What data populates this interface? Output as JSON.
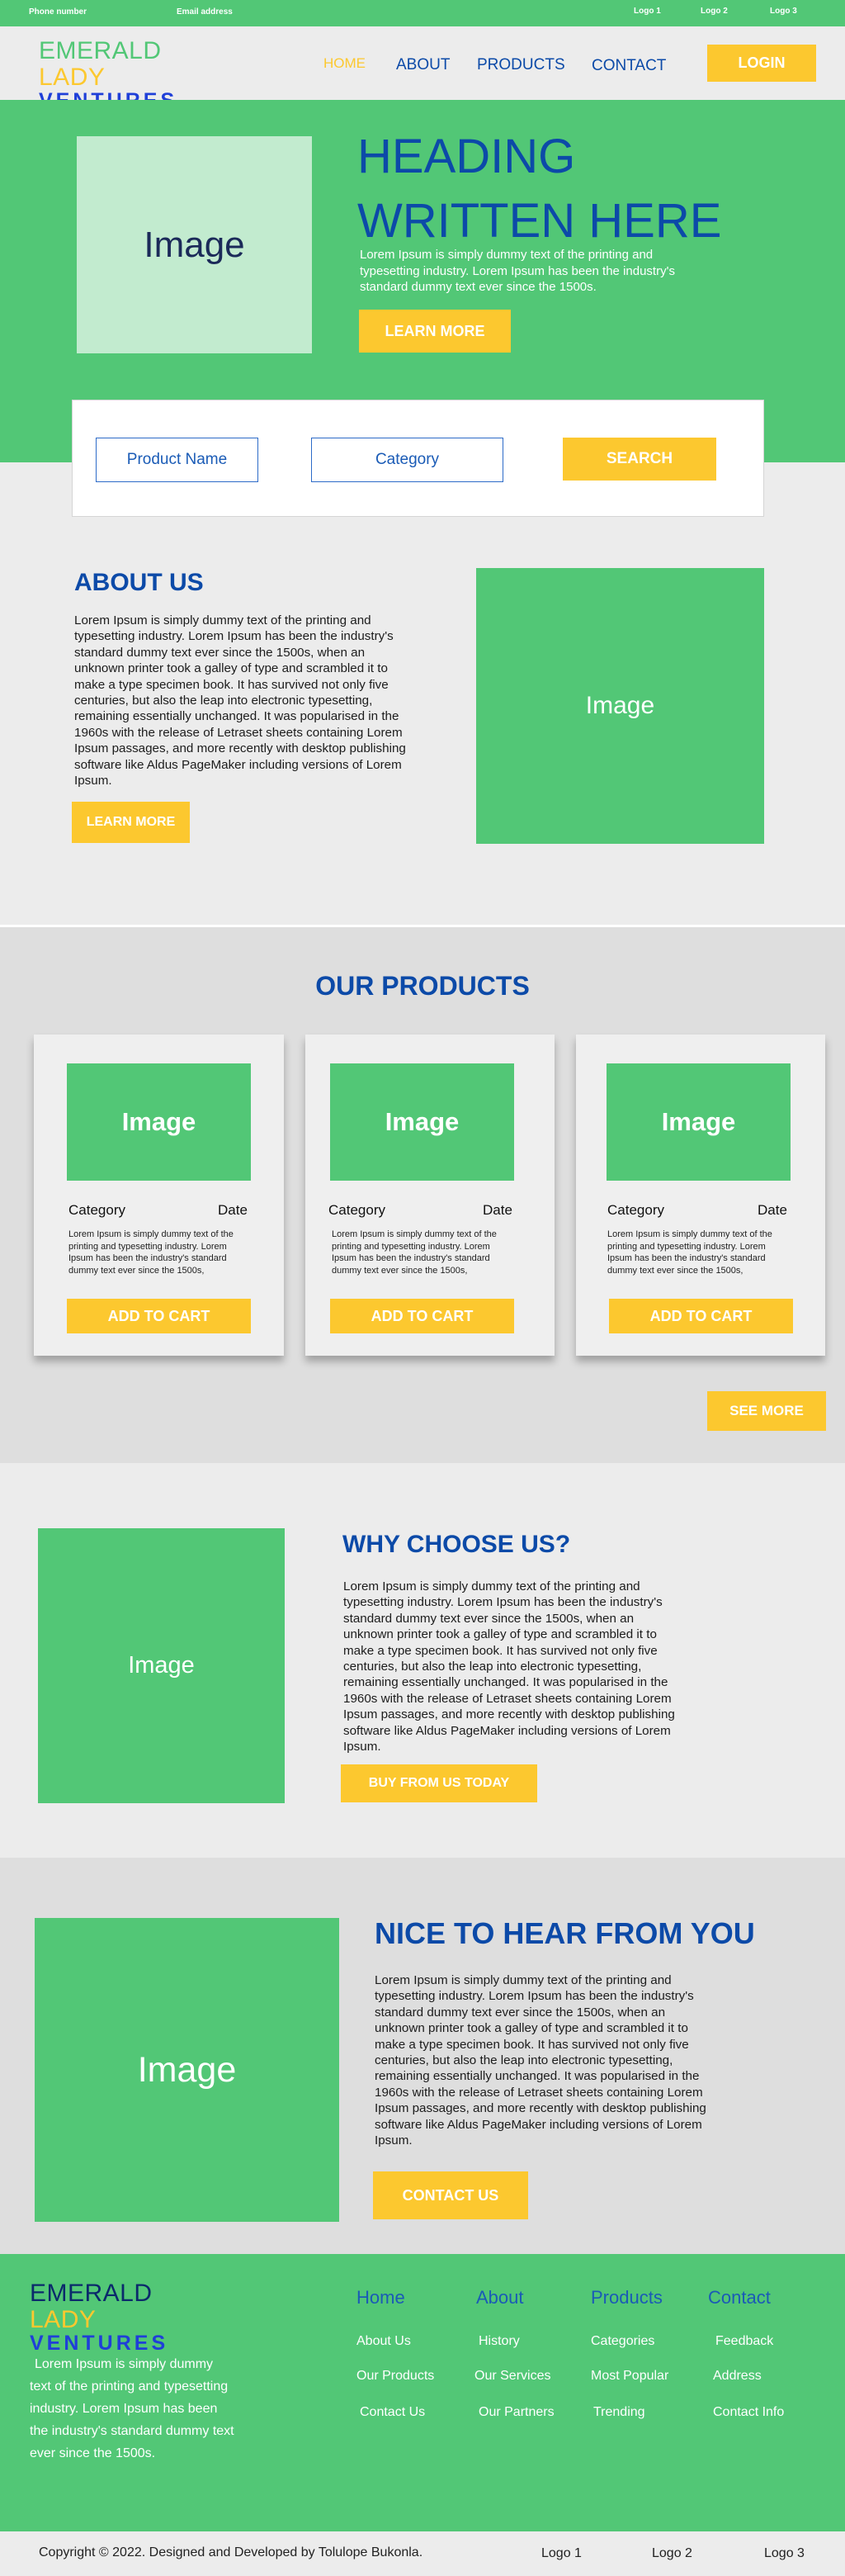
{
  "topbar": {
    "phone": "Phone number",
    "email": "Email address",
    "logos": [
      "Logo 1",
      "Logo 2",
      "Logo 3"
    ]
  },
  "brand": {
    "part1": "EMERALD",
    "part2": "LADY",
    "part3": "VENTURES"
  },
  "nav": {
    "items": [
      "HOME",
      "ABOUT",
      "PRODUCTS",
      "CONTACT"
    ],
    "active": "HOME",
    "login": "LOGIN"
  },
  "hero": {
    "image_label": "Image",
    "heading_line1": "HEADING",
    "heading_line2": "WRITTEN HERE",
    "text": "Lorem Ipsum is simply dummy text of the printing and typesetting industry. Lorem Ipsum has been the industry's standard dummy text ever since the 1500s.",
    "button": "LEARN MORE"
  },
  "search": {
    "product_placeholder": "Product Name",
    "category_placeholder": "Category",
    "button": "SEARCH"
  },
  "about": {
    "title": "ABOUT US",
    "text": "Lorem Ipsum is simply dummy text of the printing and typesetting industry. Lorem Ipsum has been the industry's standard dummy text ever since the 1500s, when an unknown printer took a galley of type and scrambled it to make a type specimen book. It has survived not only five centuries, but also the leap into electronic typesetting, remaining essentially unchanged. It was popularised in the 1960s with the release of Letraset sheets containing Lorem Ipsum passages, and more recently with desktop publishing software like Aldus PageMaker including versions of Lorem Ipsum.",
    "button": "LEARN MORE",
    "image_label": "Image"
  },
  "products": {
    "title": "OUR PRODUCTS",
    "cards": [
      {
        "image_label": "Image",
        "category": "Category",
        "date": "Date",
        "text": "Lorem Ipsum is simply dummy text of the printing and typesetting industry. Lorem Ipsum has been the industry's standard dummy text ever since the 1500s,",
        "button": "ADD TO CART"
      },
      {
        "image_label": "Image",
        "category": "Category",
        "date": "Date",
        "text": "Lorem Ipsum is simply dummy text of the printing and typesetting industry. Lorem Ipsum has been the industry's standard dummy text ever since the 1500s,",
        "button": "ADD TO CART"
      },
      {
        "image_label": "Image",
        "category": "Category",
        "date": "Date",
        "text": "Lorem Ipsum is simply dummy text of the printing and typesetting industry. Lorem Ipsum has been the industry's standard dummy text ever since the 1500s,",
        "button": "ADD TO CART"
      }
    ],
    "see_more": "SEE MORE"
  },
  "why": {
    "title": "WHY CHOOSE US?",
    "text": "Lorem Ipsum is simply dummy text of the printing and typesetting industry. Lorem Ipsum has been the industry's standard dummy text ever since the 1500s, when an unknown printer took a galley of type and scrambled it to make a type specimen book. It has survived not only five centuries, but also the leap into electronic typesetting, remaining essentially unchanged. It was popularised in the 1960s with the release of Letraset sheets containing Lorem Ipsum passages, and more recently with desktop publishing software like Aldus PageMaker including versions of Lorem Ipsum.",
    "button": "BUY FROM US TODAY",
    "image_label": "Image"
  },
  "contact": {
    "title": "NICE TO HEAR FROM YOU",
    "text": "Lorem Ipsum is simply dummy text of the printing and typesetting industry. Lorem Ipsum has been the industry's standard dummy text ever since the 1500s, when an unknown printer took a galley of type and scrambled it to make a type specimen book. It has survived not only five centuries, but also the leap into electronic typesetting, remaining essentially unchanged. It was popularised in the 1960s with the release of Letraset sheets containing Lorem Ipsum passages, and more recently with desktop publishing software like Aldus PageMaker including versions of Lorem Ipsum.",
    "button": "CONTACT US",
    "image_label": "Image"
  },
  "footer": {
    "text": "Lorem Ipsum is simply dummy text of the printing and typesetting industry. Lorem Ipsum has been the industry's standard dummy text ever since the 1500s.",
    "columns": [
      {
        "heading": "Home",
        "links": [
          "About Us",
          "Our Products",
          "Contact Us"
        ]
      },
      {
        "heading": "About",
        "links": [
          "History",
          "Our Services",
          "Our Partners"
        ]
      },
      {
        "heading": "Products",
        "links": [
          "Categories",
          "Most Popular",
          "Trending"
        ]
      },
      {
        "heading": "Contact",
        "links": [
          "Feedback",
          "Address",
          "Contact Info"
        ]
      }
    ],
    "copyright": "Copyright © 2022.  Designed and Developed by Tolulope Bukonla.",
    "logos": [
      "Logo 1",
      "Logo 2",
      "Logo 3"
    ]
  },
  "colors": {
    "green": "#52c776",
    "yellow": "#fcc82f",
    "blue": "#1a5bb6",
    "light_grey": "#ececec",
    "mid_grey": "#dedede"
  }
}
